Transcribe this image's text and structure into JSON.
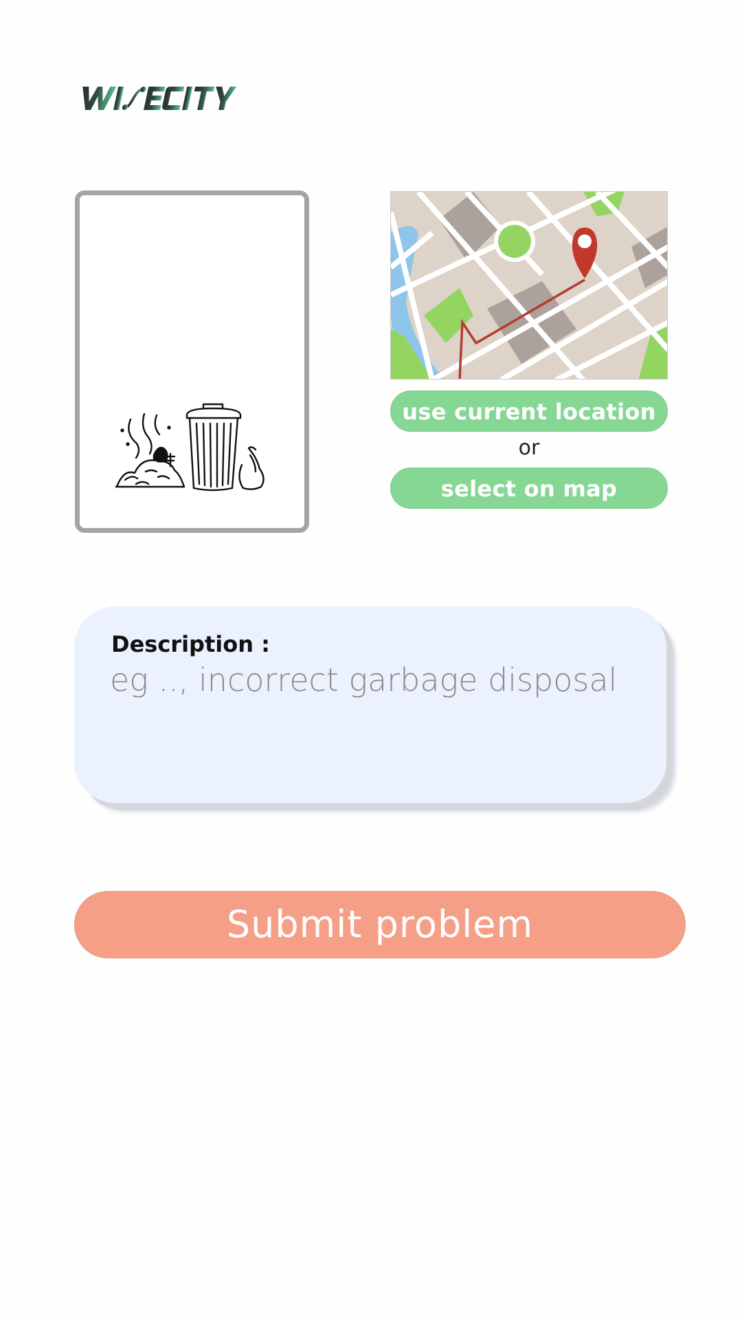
{
  "brand": {
    "logo_text": "WISECITY"
  },
  "photo": {
    "illustration_icon": "garbage-trash-can-icon"
  },
  "location": {
    "map_icon": "map-pin-icon",
    "use_current_label": "use current location",
    "or_label": "or",
    "select_on_map_label": "select on map"
  },
  "description": {
    "label": "Description :",
    "value": "",
    "placeholder": "eg .., incorrect garbage disposal"
  },
  "submit": {
    "label": "Submit problem"
  },
  "colors": {
    "location_button": "#86d694",
    "submit_button": "#f59f87",
    "description_background": "#ebf1fd",
    "brand_dark": "#2f3a36",
    "brand_accent": "#4caf86"
  }
}
